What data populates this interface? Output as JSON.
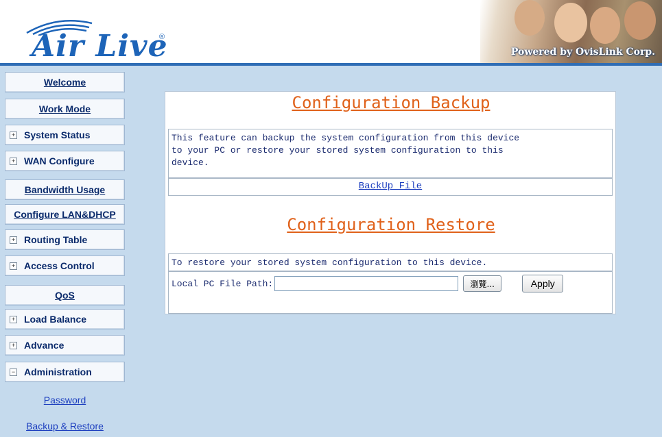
{
  "header": {
    "logo_text": "Air Live",
    "logo_reg": "®",
    "powered_by": "Powered by OvisLink Corp."
  },
  "sidebar": {
    "items": [
      {
        "label": "Welcome",
        "type": "link"
      },
      {
        "label": "Work Mode",
        "type": "link"
      },
      {
        "label": "System Status",
        "type": "expand",
        "state": "+"
      },
      {
        "label": "WAN Configure",
        "type": "expand",
        "state": "+"
      },
      {
        "label": "Bandwidth Usage",
        "type": "link"
      },
      {
        "label": "Configure LAN&DHCP",
        "type": "link"
      },
      {
        "label": "Routing Table",
        "type": "expand",
        "state": "+"
      },
      {
        "label": "Access Control",
        "type": "expand",
        "state": "+"
      },
      {
        "label": "QoS",
        "type": "link"
      },
      {
        "label": "Load Balance",
        "type": "expand",
        "state": "+"
      },
      {
        "label": "Advance",
        "type": "expand",
        "state": "+"
      },
      {
        "label": "Administration",
        "type": "expand",
        "state": "−"
      }
    ],
    "subitems": [
      {
        "label": "Password"
      },
      {
        "label": "Backup & Restore"
      }
    ]
  },
  "main": {
    "backup_title": "Configuration Backup",
    "backup_desc_lines": [
      "This feature can backup the system configuration from this device",
      "to your PC or restore your stored system configuration to this",
      "device."
    ],
    "backup_link": "BackUp File",
    "restore_title": "Configuration Restore",
    "restore_desc": "To restore your stored system configuration to this device.",
    "file_path_label": "Local PC File Path:",
    "file_path_value": "",
    "browse_label": "瀏覽...",
    "apply_label": "Apply"
  },
  "colors": {
    "accent_orange": "#e0611a",
    "link_blue": "#1d3fbf",
    "nav_text": "#0a2a6b",
    "background": "#c5daed"
  }
}
